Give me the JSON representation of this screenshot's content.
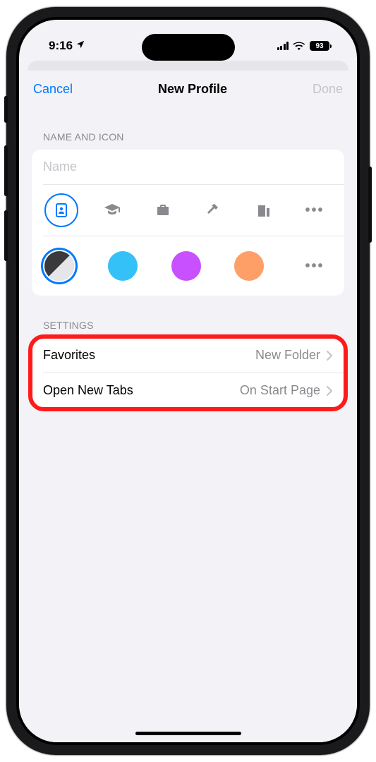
{
  "status": {
    "time": "9:16",
    "battery": "93"
  },
  "nav": {
    "cancel": "Cancel",
    "title": "New Profile",
    "done": "Done"
  },
  "sections": {
    "name_icon_header": "NAME AND ICON",
    "settings_header": "SETTINGS"
  },
  "name_input": {
    "placeholder": "Name",
    "value": ""
  },
  "settings_rows": {
    "favorites": {
      "label": "Favorites",
      "value": "New Folder"
    },
    "open_new_tabs": {
      "label": "Open New Tabs",
      "value": "On Start Page"
    }
  }
}
